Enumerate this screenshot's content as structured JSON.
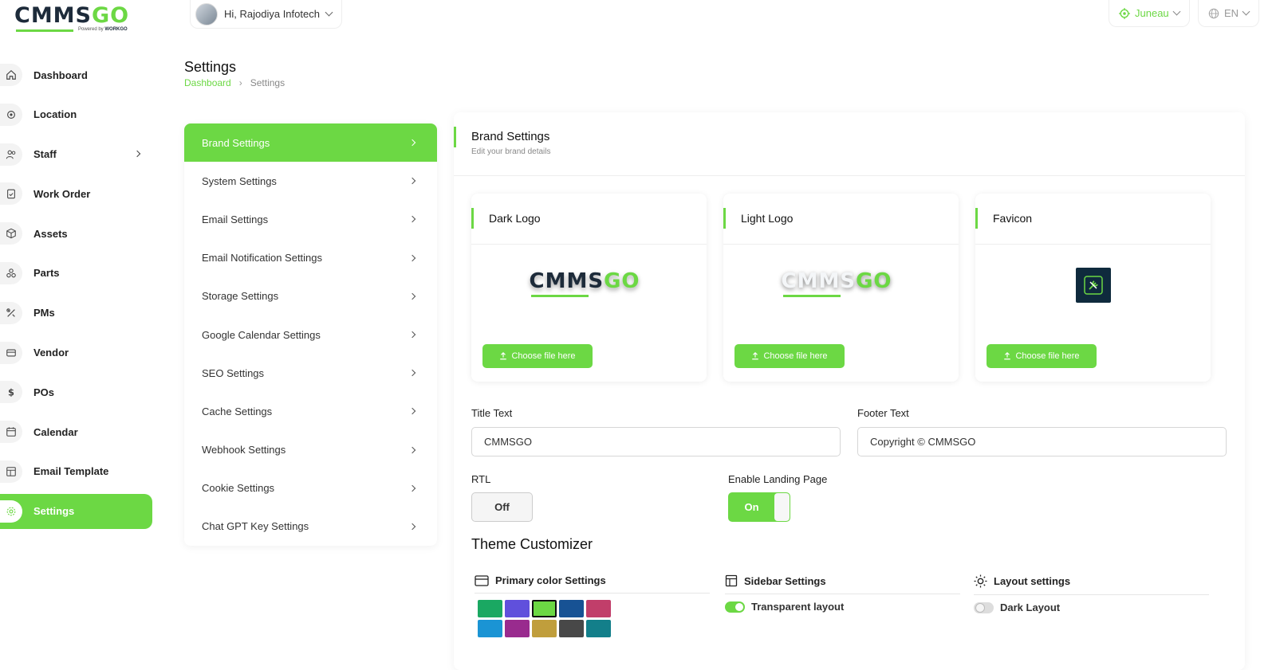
{
  "header": {
    "logo_main": "CMMS",
    "logo_accent": "GO",
    "logo_powered": "Powered by",
    "logo_brand": "WORKGO",
    "user_greeting": "Hi, Rajodiya Infotech",
    "location": "Juneau",
    "language": "EN"
  },
  "sidebar": {
    "items": [
      {
        "label": "Dashboard",
        "icon": "home-icon"
      },
      {
        "label": "Location",
        "icon": "location-icon"
      },
      {
        "label": "Staff",
        "icon": "users-icon"
      },
      {
        "label": "Work Order",
        "icon": "clipboard-icon"
      },
      {
        "label": "Assets",
        "icon": "box-icon"
      },
      {
        "label": "Parts",
        "icon": "parts-icon"
      },
      {
        "label": "PMs",
        "icon": "tools-icon"
      },
      {
        "label": "Vendor",
        "icon": "card-icon"
      },
      {
        "label": "POs",
        "icon": "dollar-icon"
      },
      {
        "label": "Calendar",
        "icon": "calendar-icon"
      },
      {
        "label": "Email Template",
        "icon": "template-icon"
      },
      {
        "label": "Settings",
        "icon": "gear-icon"
      }
    ]
  },
  "page": {
    "title": "Settings",
    "breadcrumb_home": "Dashboard",
    "breadcrumb_current": "Settings"
  },
  "settings_menu": {
    "items": [
      "Brand Settings",
      "System Settings",
      "Email Settings",
      "Email Notification Settings",
      "Storage Settings",
      "Google Calendar Settings",
      "SEO Settings",
      "Cache Settings",
      "Webhook Settings",
      "Cookie Settings",
      "Chat GPT Key Settings"
    ]
  },
  "brand": {
    "title": "Brand Settings",
    "subtitle": "Edit your brand details",
    "dark_logo_title": "Dark Logo",
    "light_logo_title": "Light Logo",
    "favicon_title": "Favicon",
    "choose_file_label": "Choose file here",
    "title_text_label": "Title Text",
    "title_text_value": "CMMSGO",
    "footer_text_label": "Footer Text",
    "footer_text_value": "Copyright © CMMSGO",
    "rtl_label": "RTL",
    "rtl_value": "Off",
    "landing_label": "Enable Landing Page",
    "landing_value": "On"
  },
  "theme": {
    "title": "Theme Customizer",
    "primary_color_label": "Primary color Settings",
    "sidebar_settings_label": "Sidebar Settings",
    "transparent_layout_label": "Transparent layout",
    "layout_settings_label": "Layout settings",
    "dark_layout_label": "Dark Layout",
    "swatches": [
      "#1aa862",
      "#6050dc",
      "#6cd844",
      "#175294",
      "#c13e6a",
      "#1b94d4",
      "#992b8e",
      "#c09e3c",
      "#484848",
      "#137f8a"
    ],
    "selected_swatch": "#6cd844"
  },
  "colors": {
    "accent": "#6cd844",
    "dark": "#1d2b3a"
  }
}
